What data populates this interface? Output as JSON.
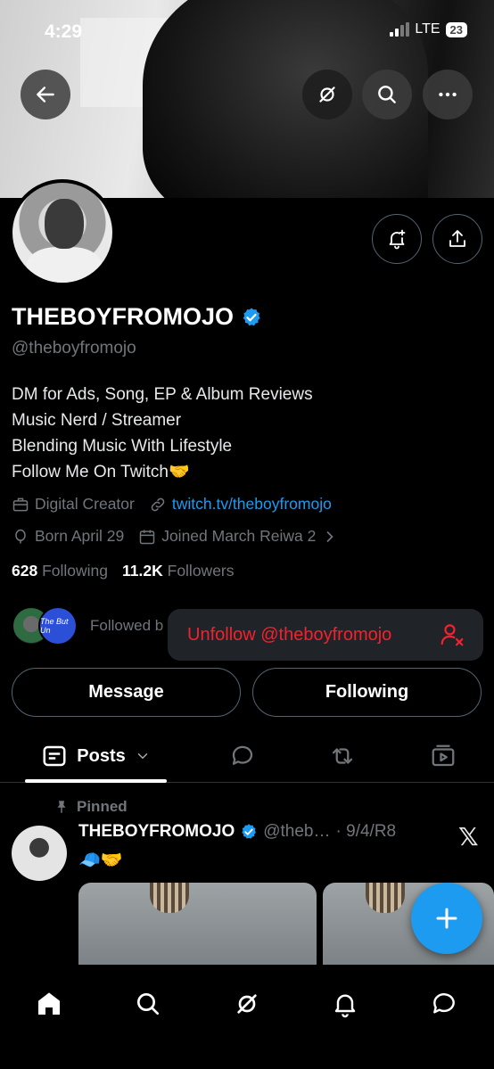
{
  "status_bar": {
    "time": "4:29",
    "network": "LTE",
    "battery": "23"
  },
  "profile": {
    "display_name": "THEBOYFROMOJO",
    "handle": "@theboyfromojo",
    "bio": [
      "DM for Ads, Song, EP & Album Reviews",
      "Music Nerd / Streamer",
      "Blending Music With Lifestyle",
      "Follow Me On Twitch🤝"
    ],
    "category": "Digital Creator",
    "website": "twitch.tv/theboyfromojo",
    "born": "Born April 29",
    "joined": "Joined March Reiwa 2",
    "following_count": "628",
    "following_label": "Following",
    "followers_count": "11.2K",
    "followers_label": "Followers",
    "followed_by_text": "Followed b",
    "mini_avatar_text": "The But Un"
  },
  "popup": {
    "unfollow_label": "Unfollow @theboyfromojo"
  },
  "actions": {
    "message": "Message",
    "following": "Following"
  },
  "tabs": {
    "posts": "Posts"
  },
  "post": {
    "pinned_label": "Pinned",
    "author": "THEBOYFROMOJO",
    "handle_trunc": "@theb…",
    "date": "· 9/4/R8",
    "text": "🧢🤝"
  },
  "colors": {
    "accent": "#1d9bf0",
    "danger": "#f4212e",
    "muted": "#71767b"
  },
  "icons": [
    "back-arrow-icon",
    "grok-icon",
    "search-icon",
    "more-icon",
    "notify-bell-icon",
    "share-icon",
    "verified-icon",
    "briefcase-icon",
    "link-icon",
    "balloon-icon",
    "calendar-icon",
    "chevron-right-icon",
    "remove-user-icon",
    "posts-icon",
    "chevron-down-icon",
    "reply-icon",
    "repost-icon",
    "media-icon",
    "pin-icon",
    "x-logo-icon",
    "plus-icon",
    "home-icon",
    "bell-icon",
    "messages-icon"
  ]
}
